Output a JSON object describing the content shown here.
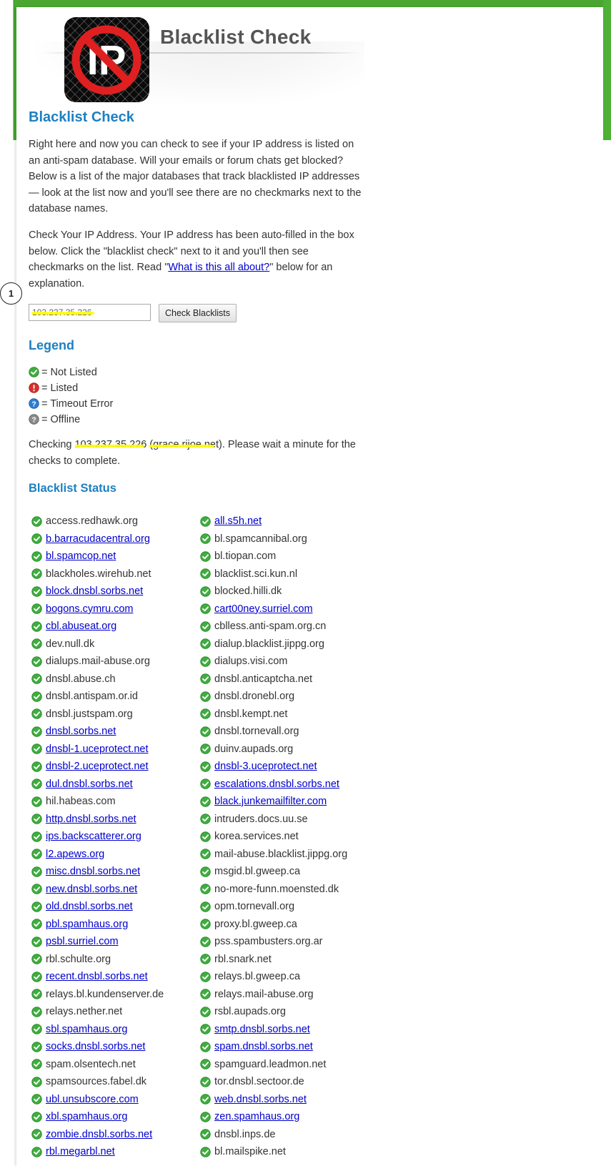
{
  "header": {
    "logo_text": "IP",
    "site_title": "Blacklist Check"
  },
  "intro": {
    "heading": "Blacklist Check",
    "paragraph1": "Right here and now you can check to see if your IP address is listed on an anti-spam database. Will your emails or forum chats get blocked? Below is a list of the major databases that track blacklisted IP addresses — look at the list now and you'll see there are no checkmarks next to the database names.",
    "paragraph2_before": "Check Your IP Address. Your IP address has been auto-filled in the box below. Click the \"blacklist check\" next to it and you'll then see checkmarks on the list. Read \"",
    "paragraph2_link": "What is this all about?",
    "paragraph2_after": "\" below for an explanation."
  },
  "annotation": {
    "marker_label": "1"
  },
  "form": {
    "ip_value": "103.237.35.226",
    "check_button_label": "Check Blacklists"
  },
  "legend": {
    "heading": "Legend",
    "not_listed": "= Not Listed",
    "listed": "= Listed",
    "timeout": "= Timeout Error",
    "offline": "= Offline"
  },
  "checking": {
    "prefix": "Checking ",
    "ip": "103.237.35.226",
    "open": " (",
    "host": "grace.rijoe.net",
    "suffix": "). Please wait a minute for the checks to complete."
  },
  "status": {
    "heading": "Blacklist Status",
    "items": [
      {
        "name": "access.redhawk.org",
        "link": false
      },
      {
        "name": "all.s5h.net",
        "link": true
      },
      {
        "name": "b.barracudacentral.org",
        "link": true
      },
      {
        "name": "bl.spamcannibal.org",
        "link": false
      },
      {
        "name": "bl.spamcop.net",
        "link": true
      },
      {
        "name": "bl.tiopan.com",
        "link": false
      },
      {
        "name": "blackholes.wirehub.net",
        "link": false
      },
      {
        "name": "blacklist.sci.kun.nl",
        "link": false
      },
      {
        "name": "block.dnsbl.sorbs.net",
        "link": true
      },
      {
        "name": "blocked.hilli.dk",
        "link": false
      },
      {
        "name": "bogons.cymru.com",
        "link": true
      },
      {
        "name": "cart00ney.surriel.com",
        "link": true
      },
      {
        "name": "cbl.abuseat.org",
        "link": true
      },
      {
        "name": "cblless.anti-spam.org.cn",
        "link": false
      },
      {
        "name": "dev.null.dk",
        "link": false
      },
      {
        "name": "dialup.blacklist.jippg.org",
        "link": false
      },
      {
        "name": "dialups.mail-abuse.org",
        "link": false
      },
      {
        "name": "dialups.visi.com",
        "link": false
      },
      {
        "name": "dnsbl.abuse.ch",
        "link": false
      },
      {
        "name": "dnsbl.anticaptcha.net",
        "link": false
      },
      {
        "name": "dnsbl.antispam.or.id",
        "link": false
      },
      {
        "name": "dnsbl.dronebl.org",
        "link": false
      },
      {
        "name": "dnsbl.justspam.org",
        "link": false
      },
      {
        "name": "dnsbl.kempt.net",
        "link": false
      },
      {
        "name": "dnsbl.sorbs.net",
        "link": true
      },
      {
        "name": "dnsbl.tornevall.org",
        "link": false
      },
      {
        "name": "dnsbl-1.uceprotect.net",
        "link": true
      },
      {
        "name": "duinv.aupads.org",
        "link": false
      },
      {
        "name": "dnsbl-2.uceprotect.net",
        "link": true
      },
      {
        "name": "dnsbl-3.uceprotect.net",
        "link": true
      },
      {
        "name": "dul.dnsbl.sorbs.net",
        "link": true
      },
      {
        "name": "escalations.dnsbl.sorbs.net",
        "link": true
      },
      {
        "name": "hil.habeas.com",
        "link": false
      },
      {
        "name": "black.junkemailfilter.com",
        "link": true
      },
      {
        "name": "http.dnsbl.sorbs.net",
        "link": true
      },
      {
        "name": "intruders.docs.uu.se",
        "link": false
      },
      {
        "name": "ips.backscatterer.org",
        "link": true
      },
      {
        "name": "korea.services.net",
        "link": false
      },
      {
        "name": "l2.apews.org",
        "link": true
      },
      {
        "name": "mail-abuse.blacklist.jippg.org",
        "link": false
      },
      {
        "name": "misc.dnsbl.sorbs.net",
        "link": true
      },
      {
        "name": "msgid.bl.gweep.ca",
        "link": false
      },
      {
        "name": "new.dnsbl.sorbs.net",
        "link": true
      },
      {
        "name": "no-more-funn.moensted.dk",
        "link": false
      },
      {
        "name": "old.dnsbl.sorbs.net",
        "link": true
      },
      {
        "name": "opm.tornevall.org",
        "link": false
      },
      {
        "name": "pbl.spamhaus.org",
        "link": true
      },
      {
        "name": "proxy.bl.gweep.ca",
        "link": false
      },
      {
        "name": "psbl.surriel.com",
        "link": true
      },
      {
        "name": "pss.spambusters.org.ar",
        "link": false
      },
      {
        "name": "rbl.schulte.org",
        "link": false
      },
      {
        "name": "rbl.snark.net",
        "link": false
      },
      {
        "name": "recent.dnsbl.sorbs.net",
        "link": true
      },
      {
        "name": "relays.bl.gweep.ca",
        "link": false
      },
      {
        "name": "relays.bl.kundenserver.de",
        "link": false
      },
      {
        "name": "relays.mail-abuse.org",
        "link": false
      },
      {
        "name": "relays.nether.net",
        "link": false
      },
      {
        "name": "rsbl.aupads.org",
        "link": false
      },
      {
        "name": "sbl.spamhaus.org",
        "link": true
      },
      {
        "name": "smtp.dnsbl.sorbs.net",
        "link": true
      },
      {
        "name": "socks.dnsbl.sorbs.net",
        "link": true
      },
      {
        "name": "spam.dnsbl.sorbs.net",
        "link": true
      },
      {
        "name": "spam.olsentech.net",
        "link": false
      },
      {
        "name": "spamguard.leadmon.net",
        "link": false
      },
      {
        "name": "spamsources.fabel.dk",
        "link": false
      },
      {
        "name": "tor.dnsbl.sectoor.de",
        "link": false
      },
      {
        "name": "ubl.unsubscore.com",
        "link": true
      },
      {
        "name": "web.dnsbl.sorbs.net",
        "link": true
      },
      {
        "name": "xbl.spamhaus.org",
        "link": true
      },
      {
        "name": "zen.spamhaus.org",
        "link": true
      },
      {
        "name": "zombie.dnsbl.sorbs.net",
        "link": true
      },
      {
        "name": "dnsbl.inps.de",
        "link": false
      },
      {
        "name": "rbl.megarbl.net",
        "link": true
      },
      {
        "name": "bl.mailspike.net",
        "link": false
      }
    ]
  },
  "colors": {
    "accent_green": "#4aa531",
    "heading_blue": "#1e80c0",
    "link_blue": "#0000cc",
    "ok_green": "#3fae3f",
    "listed_red": "#d9302b",
    "timeout_blue": "#2f7fcf",
    "offline_gray": "#8a8a8a",
    "highlight_yellow": "#ffff00"
  }
}
